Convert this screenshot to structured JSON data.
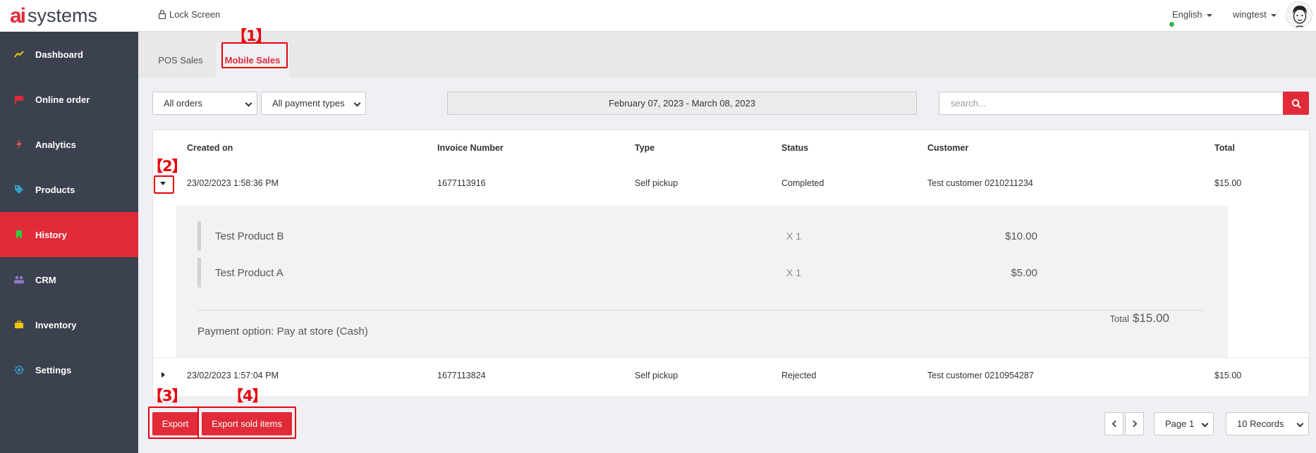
{
  "brand": {
    "logo_mark": "ai",
    "logo_text": "systems"
  },
  "sidebar": {
    "items": [
      {
        "label": "Dashboard",
        "icon": "trend-line-icon"
      },
      {
        "label": "Online order",
        "icon": "flag-icon"
      },
      {
        "label": "Analytics",
        "icon": "bolt-icon"
      },
      {
        "label": "Products",
        "icon": "tag-icon"
      },
      {
        "label": "History",
        "icon": "bookmark-icon",
        "active": true
      },
      {
        "label": "CRM",
        "icon": "users-icon"
      },
      {
        "label": "Inventory",
        "icon": "briefcase-icon"
      },
      {
        "label": "Settings",
        "icon": "gear-icon"
      }
    ]
  },
  "topbar": {
    "lock_label": "Lock Screen",
    "language": "English",
    "username": "wingtest"
  },
  "tabs": [
    {
      "label": "POS Sales",
      "active": false
    },
    {
      "label": "Mobile Sales",
      "active": true
    }
  ],
  "annotations": {
    "a1": "【1】",
    "a2": "【2】",
    "a3": "【3】",
    "a4": "【4】"
  },
  "filters": {
    "order_filter": "All orders",
    "payment_filter": "All payment types",
    "date_range": "February 07, 2023 - March 08, 2023",
    "search_placeholder": "search..."
  },
  "table": {
    "headers": [
      "Created on",
      "Invoice Number",
      "Type",
      "Status",
      "Customer",
      "Total"
    ],
    "rows": [
      {
        "created": "23/02/2023 1:58:36 PM",
        "invoice": "1677113916",
        "type": "Self pickup",
        "status": "Completed",
        "customer": "Test customer 0210211234",
        "total": "$15.00",
        "expanded": true
      },
      {
        "created": "23/02/2023 1:57:04 PM",
        "invoice": "1677113824",
        "type": "Self pickup",
        "status": "Rejected",
        "customer": "Test customer 0210954287",
        "total": "$15.00",
        "expanded": false
      }
    ],
    "detail": {
      "items": [
        {
          "name": "Test Product B",
          "qty": "X 1",
          "price": "$10.00"
        },
        {
          "name": "Test Product A",
          "qty": "X 1",
          "price": "$5.00"
        }
      ],
      "total_label": "Total",
      "total_value": "$15.00",
      "payment": "Payment option: Pay at store (Cash)"
    }
  },
  "bottom": {
    "export_label": "Export",
    "export_sold_label": "Export sold items",
    "page_select": "Page 1",
    "records_select": "10 Records"
  },
  "colors": {
    "accent": "#e12b38",
    "sidebar": "#3c414f",
    "annotation": "#e8000b"
  }
}
